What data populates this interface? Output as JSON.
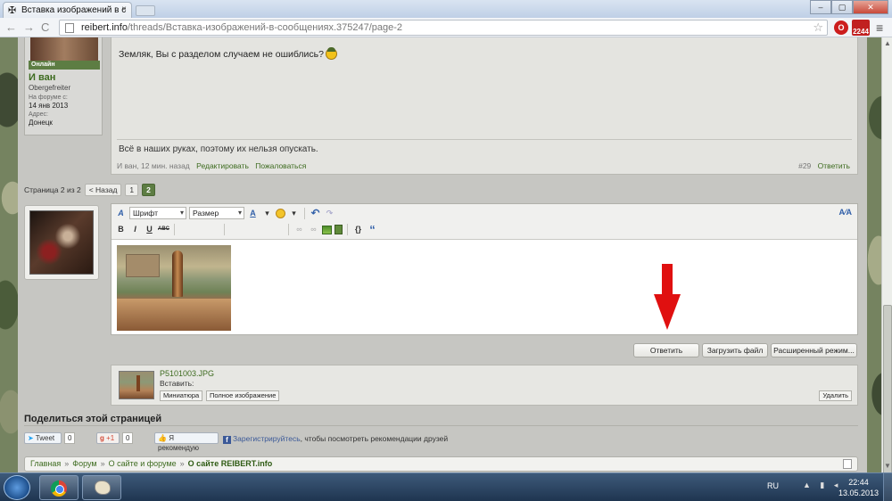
{
  "browser": {
    "tab_title": "Вставка изображений в с",
    "tab_close": "×",
    "tab_icon": "✠",
    "url_domain": "reibert.info",
    "url_path": "/threads/Вставка-изображений-в-сообщениях.375247/page-2",
    "ext_badge": "2244",
    "back": "←",
    "forward": "→",
    "reload": "C",
    "star": "☆",
    "menu": "≡"
  },
  "post": {
    "online_label": "Онлайн",
    "username": "И ван",
    "user_title": "Obergefreiter",
    "joined_label": "На форуме с:",
    "joined_value": "14 янв 2013",
    "address_label": "Адрес:",
    "address_value": "Донецк",
    "message": "Земляк, Вы с разделом случаем не ошиблись?",
    "signature": "Всё в наших руках, поэтому их нельзя опускать.",
    "meta_author_time": "И ван, 12 мин. назад",
    "edit_link": "Редактировать",
    "report_link": "Пожаловаться",
    "post_number": "#29",
    "reply_link": "Ответить"
  },
  "pagination": {
    "label": "Страница 2 из 2",
    "prev": "< Назад",
    "pages": [
      "1",
      "2"
    ],
    "current": "2"
  },
  "editor": {
    "font_select": "Шрифт",
    "size_select": "Размер",
    "bold": "B",
    "italic": "I",
    "underline": "U",
    "strike": "ABC",
    "text_color": "A",
    "undo": "↶",
    "redo": "↷",
    "code": "{}",
    "quote": "“",
    "unlink": "∞",
    "link": "∞",
    "remove_format": "A"
  },
  "actions": {
    "reply_button": "Ответить",
    "upload_button": "Загрузить файл",
    "advanced_button": "Расширенный режим..."
  },
  "attachment": {
    "filename": "P5101003.JPG",
    "insert_label": "Вставить:",
    "thumb_button": "Миниатюра",
    "full_button": "Полное изображение",
    "delete_button": "Удалить"
  },
  "share": {
    "title": "Поделиться этой страницей",
    "tweet": "Tweet",
    "tweet_count": "0",
    "gplus": "+1",
    "gplus_count": "0",
    "fb_like": "Я рекомендую",
    "fb_icon": "f",
    "fb_register": "Зарегистрируйтесь",
    "fb_text": ", чтобы посмотреть рекомендации друзей"
  },
  "breadcrumbs": {
    "items": [
      "Главная",
      "Форум",
      "О сайте и форуме"
    ],
    "current": "О сайте REIBERT.info",
    "separator": "»"
  },
  "taskbar": {
    "lang": "RU",
    "time": "22:44",
    "date": "13.05.2013"
  },
  "colors": {
    "accent": "#3d6b1f",
    "arrow": "#e01010"
  }
}
